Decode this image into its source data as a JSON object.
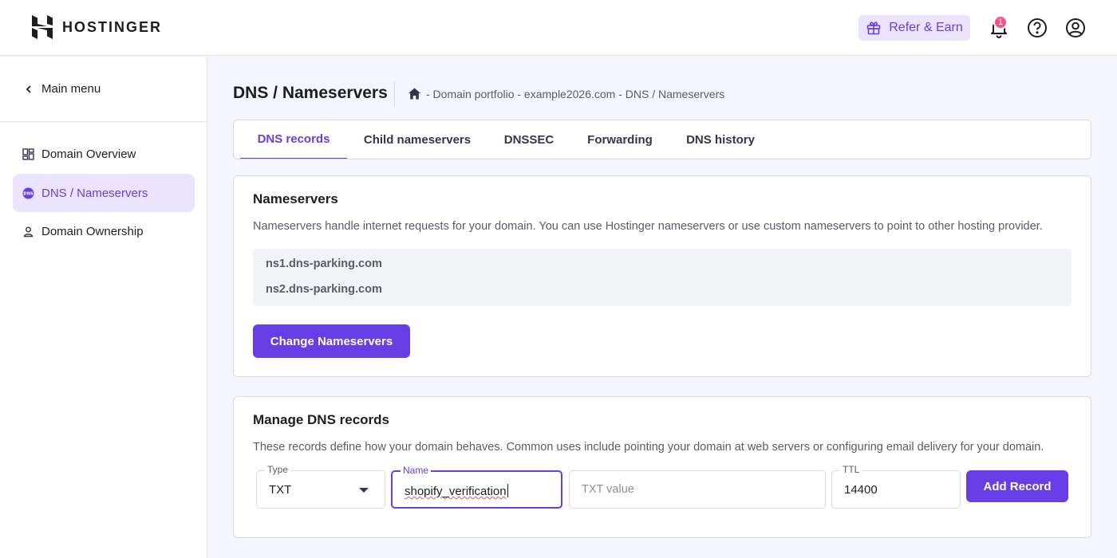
{
  "brand": {
    "name": "HOSTINGER"
  },
  "header": {
    "refer_label": "Refer & Earn",
    "notification_count": "1"
  },
  "sidebar": {
    "main_menu_label": "Main menu",
    "items": [
      {
        "label": "Domain Overview",
        "icon": "grid-icon",
        "active": false
      },
      {
        "label": "DNS / Nameservers",
        "icon": "dns-icon",
        "active": true
      },
      {
        "label": "Domain Ownership",
        "icon": "user-icon",
        "active": false
      }
    ]
  },
  "page": {
    "title": "DNS / Nameservers",
    "breadcrumb": "- Domain portfolio - example2026.com - DNS / Nameservers"
  },
  "tabs": [
    {
      "label": "DNS records",
      "active": true
    },
    {
      "label": "Child nameservers",
      "active": false
    },
    {
      "label": "DNSSEC",
      "active": false
    },
    {
      "label": "Forwarding",
      "active": false
    },
    {
      "label": "DNS history",
      "active": false
    }
  ],
  "nameservers": {
    "title": "Nameservers",
    "description": "Nameservers handle internet requests for your domain. You can use Hostinger nameservers or use custom nameservers to point to other hosting provider.",
    "list": [
      "ns1.dns-parking.com",
      "ns2.dns-parking.com"
    ],
    "change_button": "Change Nameservers"
  },
  "manage_dns": {
    "title": "Manage DNS records",
    "description": "These records define how your domain behaves. Common uses include pointing your domain at web servers or configuring email delivery for your domain.",
    "type_label": "Type",
    "type_value": "TXT",
    "name_label": "Name",
    "name_value": "shopify_verification",
    "value_placeholder": "TXT value",
    "ttl_label": "TTL",
    "ttl_value": "14400",
    "add_button": "Add Record"
  },
  "colors": {
    "accent": "#673de6",
    "accent_light": "#ebe4ff",
    "badge": "#fc5185"
  }
}
